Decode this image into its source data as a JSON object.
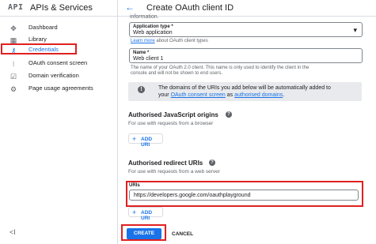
{
  "sidebar": {
    "logo": "API",
    "title": "APIs & Services",
    "items": [
      {
        "label": "Dashboard",
        "icon": "dashboard-icon",
        "glyph": "✥"
      },
      {
        "label": "Library",
        "icon": "library-icon",
        "glyph": "▦"
      },
      {
        "label": "Credentials",
        "icon": "key-icon",
        "glyph": "⚷"
      },
      {
        "label": "OAuth consent screen",
        "icon": "consent-icon",
        "glyph": "⁝"
      },
      {
        "label": "Domain verification",
        "icon": "domain-icon",
        "glyph": "☑"
      },
      {
        "label": "Page usage agreements",
        "icon": "settings-icon",
        "glyph": "⚙"
      }
    ],
    "collapse_glyph": "<I"
  },
  "header": {
    "back_glyph": "←",
    "title": "Create OAuth client ID"
  },
  "form": {
    "info_heading": "information.",
    "app_type": {
      "label": "Application type *",
      "value": "Web application",
      "dropdown_glyph": "▾"
    },
    "learn_more_link": "Learn more",
    "learn_more_rest": " about OAuth client types",
    "name": {
      "label": "Name *",
      "value": "Web client 1"
    },
    "name_hint_1": "The name of your OAuth 2.0 client. This name is only used to identify the client in the",
    "name_hint_2": "console and will not be shown to end users.",
    "info_banner": {
      "line1": "The domains of the URIs you add below will be automatically added to",
      "line2_prefix": "your ",
      "line2_link1": "OAuth consent screen",
      "line2_mid": " as ",
      "line2_link2": "authorised domains",
      "line2_suffix": "."
    },
    "js_origins": {
      "title": "Authorised JavaScript origins",
      "subtitle": "For use with requests from a browser",
      "add_label": "ADD URI"
    },
    "redirect_uris": {
      "title": "Authorised redirect URIs",
      "subtitle": "For use with requests from a web server",
      "uris_label": "URIs",
      "uri_value": "https://developers.google.com/oauthplayground",
      "add_label": "ADD URI"
    },
    "create_label": "CREATE",
    "cancel_label": "CANCEL"
  }
}
